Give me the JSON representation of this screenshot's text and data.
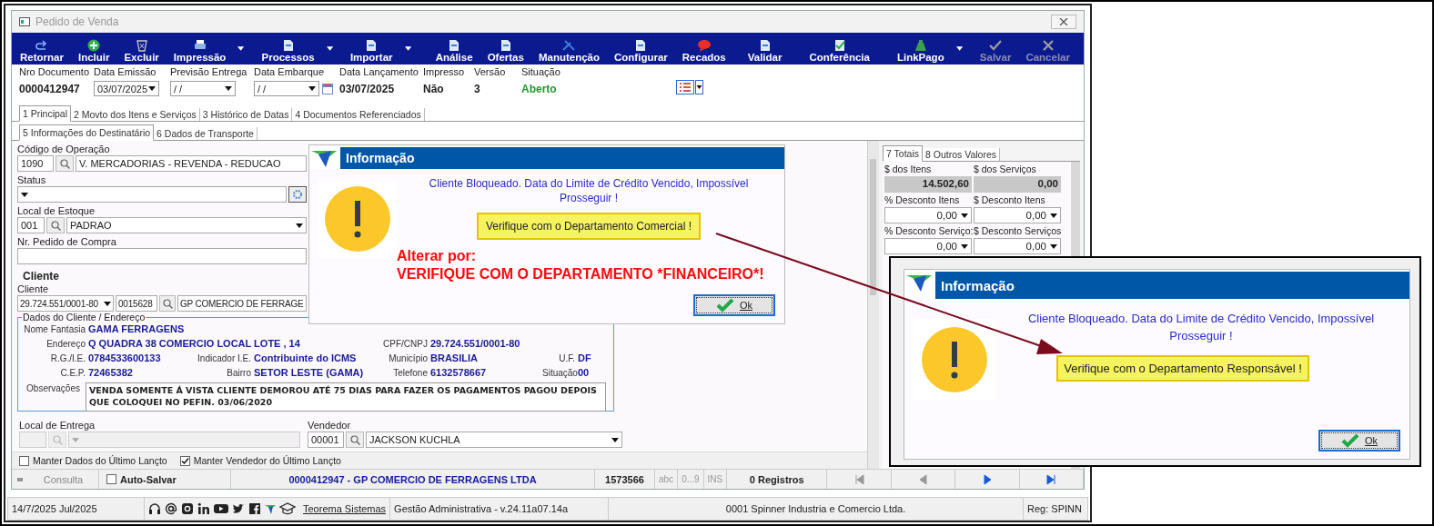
{
  "window": {
    "title": "Pedido de Venda"
  },
  "toolbar": [
    {
      "label": "Retornar",
      "menu": false,
      "disabled": false
    },
    {
      "label": "Incluir",
      "menu": false,
      "disabled": false
    },
    {
      "label": "Excluir",
      "menu": false,
      "disabled": false
    },
    {
      "label": "Impressão",
      "menu": true,
      "disabled": false
    },
    {
      "label": "Processos",
      "menu": true,
      "disabled": false
    },
    {
      "label": "Importar",
      "menu": true,
      "disabled": false
    },
    {
      "label": "Análise",
      "menu": false,
      "disabled": false
    },
    {
      "label": "Ofertas",
      "menu": false,
      "disabled": false
    },
    {
      "label": "Manutenção",
      "menu": false,
      "disabled": false
    },
    {
      "label": "Configurar",
      "menu": false,
      "disabled": false
    },
    {
      "label": "Recados",
      "menu": false,
      "disabled": false
    },
    {
      "label": "Validar",
      "menu": false,
      "disabled": false
    },
    {
      "label": "Conferência",
      "menu": false,
      "disabled": false
    },
    {
      "label": "LinkPago",
      "menu": true,
      "disabled": false
    },
    {
      "label": "Salvar",
      "menu": false,
      "disabled": true
    },
    {
      "label": "Cancelar",
      "menu": false,
      "disabled": true
    }
  ],
  "header": [
    {
      "label": "Nro Documento",
      "value": "0000412947",
      "kind": "text"
    },
    {
      "label": "Data Emissão",
      "value": "03/07/2025",
      "kind": "date"
    },
    {
      "label": "Previsão Entrega",
      "value": "/ /",
      "kind": "date"
    },
    {
      "label": "Data Embarque",
      "value": "/ /",
      "kind": "date_calendar"
    },
    {
      "label": "Data Lançamento",
      "value": "03/07/2025",
      "kind": "text"
    },
    {
      "label": "Impresso",
      "value": "Não",
      "kind": "text"
    },
    {
      "label": "Versão",
      "value": "3",
      "kind": "text"
    },
    {
      "label": "Situação",
      "value": "Aberto",
      "kind": "status"
    }
  ],
  "tabs": [
    {
      "label": "1 Principal",
      "selected": true
    },
    {
      "label": "2 Movto dos Itens e Serviços",
      "selected": false
    },
    {
      "label": "3 Histórico de Datas",
      "selected": false
    },
    {
      "label": "4 Documentos Referenciados",
      "selected": false
    }
  ],
  "subtabs": [
    {
      "label": "5 Informações do Destinatário",
      "selected": true
    },
    {
      "label": "6 Dados de Transporte",
      "selected": false
    }
  ],
  "form": {
    "operation": {
      "label": "Código de Operação",
      "code": "1090",
      "value": "V. MERCADORIAS - REVENDA - REDUCAO"
    },
    "status": {
      "label": "Status"
    },
    "stock": {
      "label": "Local de Estoque",
      "code": "001",
      "value": "PADRAO"
    },
    "purchase_order": {
      "label": "Nr. Pedido de Compra"
    },
    "client": {
      "heading": "Cliente",
      "label": "Cliente",
      "document": "29.724.551/0001-80",
      "code": "0015628",
      "name": "GP COMERCIO DE FERRAGE"
    }
  },
  "client_details": {
    "legend": "Dados do Cliente / Endereço",
    "rows": [
      [
        {
          "label": "Nome Fantasia",
          "value": "GAMA FERRAGENS"
        }
      ],
      [
        {
          "label": "Endereço",
          "value": "Q QUADRA 38 COMERCIO LOCAL LOTE , 14"
        },
        {},
        {
          "label": "CPF/CNPJ",
          "value": "29.724.551/0001-80"
        }
      ],
      [
        {
          "label": "R.G./I.E.",
          "value": "0784533600133"
        },
        {
          "label": "Indicador I.E.",
          "value": "Contribuinte do ICMS"
        },
        {
          "label": "Município",
          "value": "BRASILIA"
        },
        {
          "label": "U.F.",
          "value": "DF"
        }
      ],
      [
        {
          "label": "C.E.P.",
          "value": "72465382"
        },
        {
          "label": "Bairro",
          "value": "SETOR LESTE (GAMA)"
        },
        {
          "label": "Telefone",
          "value": "6132578667"
        },
        {
          "label": "Situação",
          "value": "00"
        }
      ]
    ],
    "notes": {
      "label": "Observações",
      "value": "VENDA SOMENTE Á VISTA  CLIENTE  DEMOROU ATÉ 75 DIAS PARA FAZER OS PAGAMENTOS PAGOU DEPOIS QUE COLOQUEI NO PEFIN. 03/06/2020"
    }
  },
  "delivery": {
    "label": "Local de Entrega"
  },
  "seller": {
    "label": "Vendedor",
    "code": "00001",
    "name": "JACKSON KUCHLA"
  },
  "options": [
    {
      "label": "Manter Dados do Último Lançto",
      "checked": false
    },
    {
      "label": "Manter Vendedor do Último Lançto",
      "checked": true
    }
  ],
  "totals": {
    "tabs": [
      {
        "label": "7 Totais",
        "selected": true
      },
      {
        "label": "8 Outros Valores",
        "selected": false
      }
    ],
    "fields": [
      {
        "label": "$ dos Itens",
        "value": "14.502,60",
        "kind": "readonly"
      },
      {
        "label": "$ dos Serviços",
        "value": "0,00",
        "kind": "readonly"
      },
      {
        "label": "% Desconto Itens",
        "value": "0,00",
        "kind": "dropdown"
      },
      {
        "label": "$ Desconto Itens",
        "value": "0,00",
        "kind": "dropdown"
      },
      {
        "label": "% Desconto Serviço:",
        "value": "0,00",
        "kind": "dropdown"
      },
      {
        "label": "$ Desconto Serviços",
        "value": "0,00",
        "kind": "dropdown"
      }
    ]
  },
  "navigator": {
    "mode": "Consulta",
    "autosave": {
      "label": "Auto-Salvar",
      "checked": false
    },
    "record": "0000412947 - GP COMERCIO DE FERRAGENS LTDA",
    "number": "1573566",
    "indicators": [
      "abc",
      "0...9",
      "INS"
    ],
    "count": "0 Registros",
    "buttons": [
      {
        "kind": "first",
        "disabled": true
      },
      {
        "kind": "previous",
        "disabled": true
      },
      {
        "kind": "next",
        "disabled": false
      },
      {
        "kind": "last",
        "disabled": false
      }
    ]
  },
  "status_bar": {
    "date": "14/7/2025 Jul/2025",
    "link": "Teorema Sistemas",
    "version": "Gestão Administrativa - v.24.11a07.14a",
    "company": "0001 Spinner Industria e Comercio Ltda.",
    "registration": "Reg: SPINN"
  },
  "dialogs": [
    {
      "title": "Informação",
      "message": "Cliente Bloqueado. Data do Limite de Crédito Vencido, Impossível Prosseguir !",
      "highlight": "Verifique com o Departamento Comercial !",
      "annotation": [
        "Alterar por:",
        "VERIFIQUE COM O DEPARTAMENTO *FINANCEIRO*!"
      ],
      "button": "Ok"
    },
    {
      "title": "Informação",
      "message": "Cliente Bloqueado. Data do Limite de Crédito Vencido, Impossível Prosseguir !",
      "highlight": "Verifique com o Departamento Responsável !",
      "button": "Ok"
    }
  ]
}
